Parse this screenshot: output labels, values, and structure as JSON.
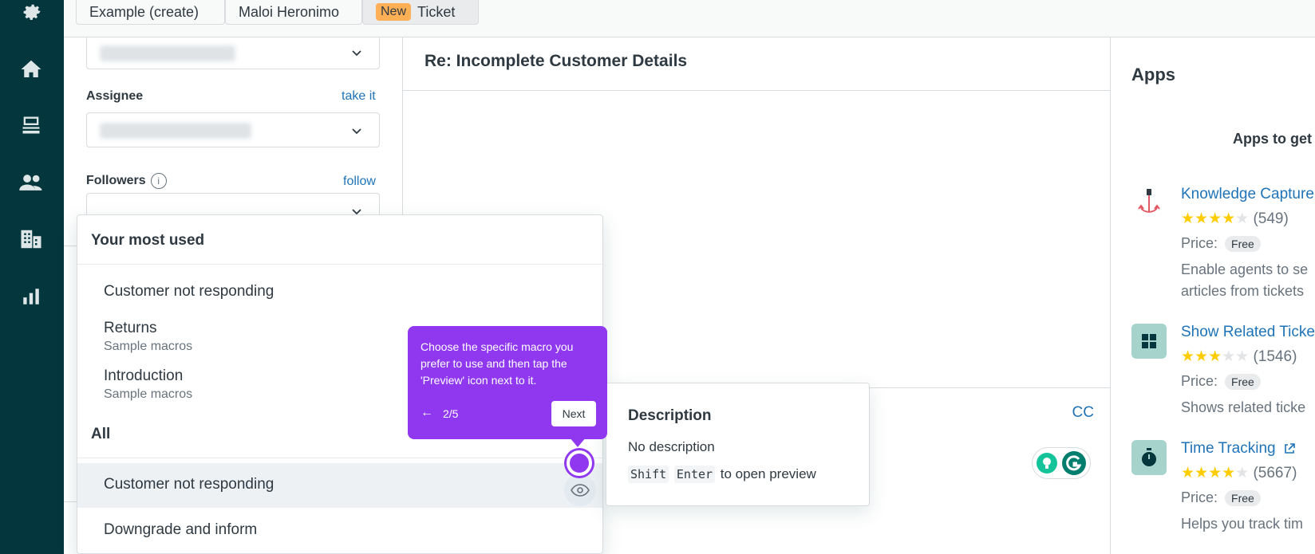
{
  "tabs": {
    "tab1": "Example (create)",
    "tab2": "Maloi Heronimo",
    "tab3_badge": "New",
    "tab3_label": "Ticket"
  },
  "props": {
    "assignee_label": "Assignee",
    "assignee_action": "take it",
    "followers_label": "Followers",
    "followers_info": "i",
    "followers_action": "follow"
  },
  "conversation": {
    "subject": "Re: Incomplete Customer Details",
    "cc": "CC"
  },
  "apps": {
    "title": "Apps",
    "subtitle": "Apps to get",
    "price_label": "Price:",
    "items": [
      {
        "name": "Knowledge Capture",
        "rating_count": "(549)",
        "stars": 4,
        "price": "Free",
        "desc1": "Enable agents to se",
        "desc2": "articles from tickets"
      },
      {
        "name": "Show Related Ticke",
        "rating_count": "(1546)",
        "stars": 3,
        "price": "Free",
        "desc1": "Shows related ticke"
      },
      {
        "name": "Time Tracking",
        "rating_count": "(5667)",
        "stars": 4,
        "price": "Free",
        "desc1": "Helps you track tim"
      }
    ]
  },
  "macros": {
    "most_used_header": "Your most used",
    "most_used": [
      {
        "label": "Customer not responding"
      },
      {
        "label": "Returns",
        "sub": "Sample macros"
      },
      {
        "label": "Introduction",
        "sub": "Sample macros"
      }
    ],
    "all_header": "All",
    "all": [
      {
        "label": "Customer not responding"
      },
      {
        "label": "Downgrade and inform"
      }
    ]
  },
  "description": {
    "title": "Description",
    "text": "No description",
    "key1": "Shift",
    "key2": "Enter",
    "hint": "to open preview"
  },
  "tour": {
    "text": "Choose the specific macro you prefer to use and then tap the 'Preview' icon next to it.",
    "back": "←",
    "step": "2/5",
    "next": "Next"
  },
  "colors": {
    "nav_bg": "#03363d",
    "link": "#1f73b7",
    "tour_purple": "#9038ef",
    "new_badge": "#ffb057",
    "star": "#ffcc00"
  }
}
